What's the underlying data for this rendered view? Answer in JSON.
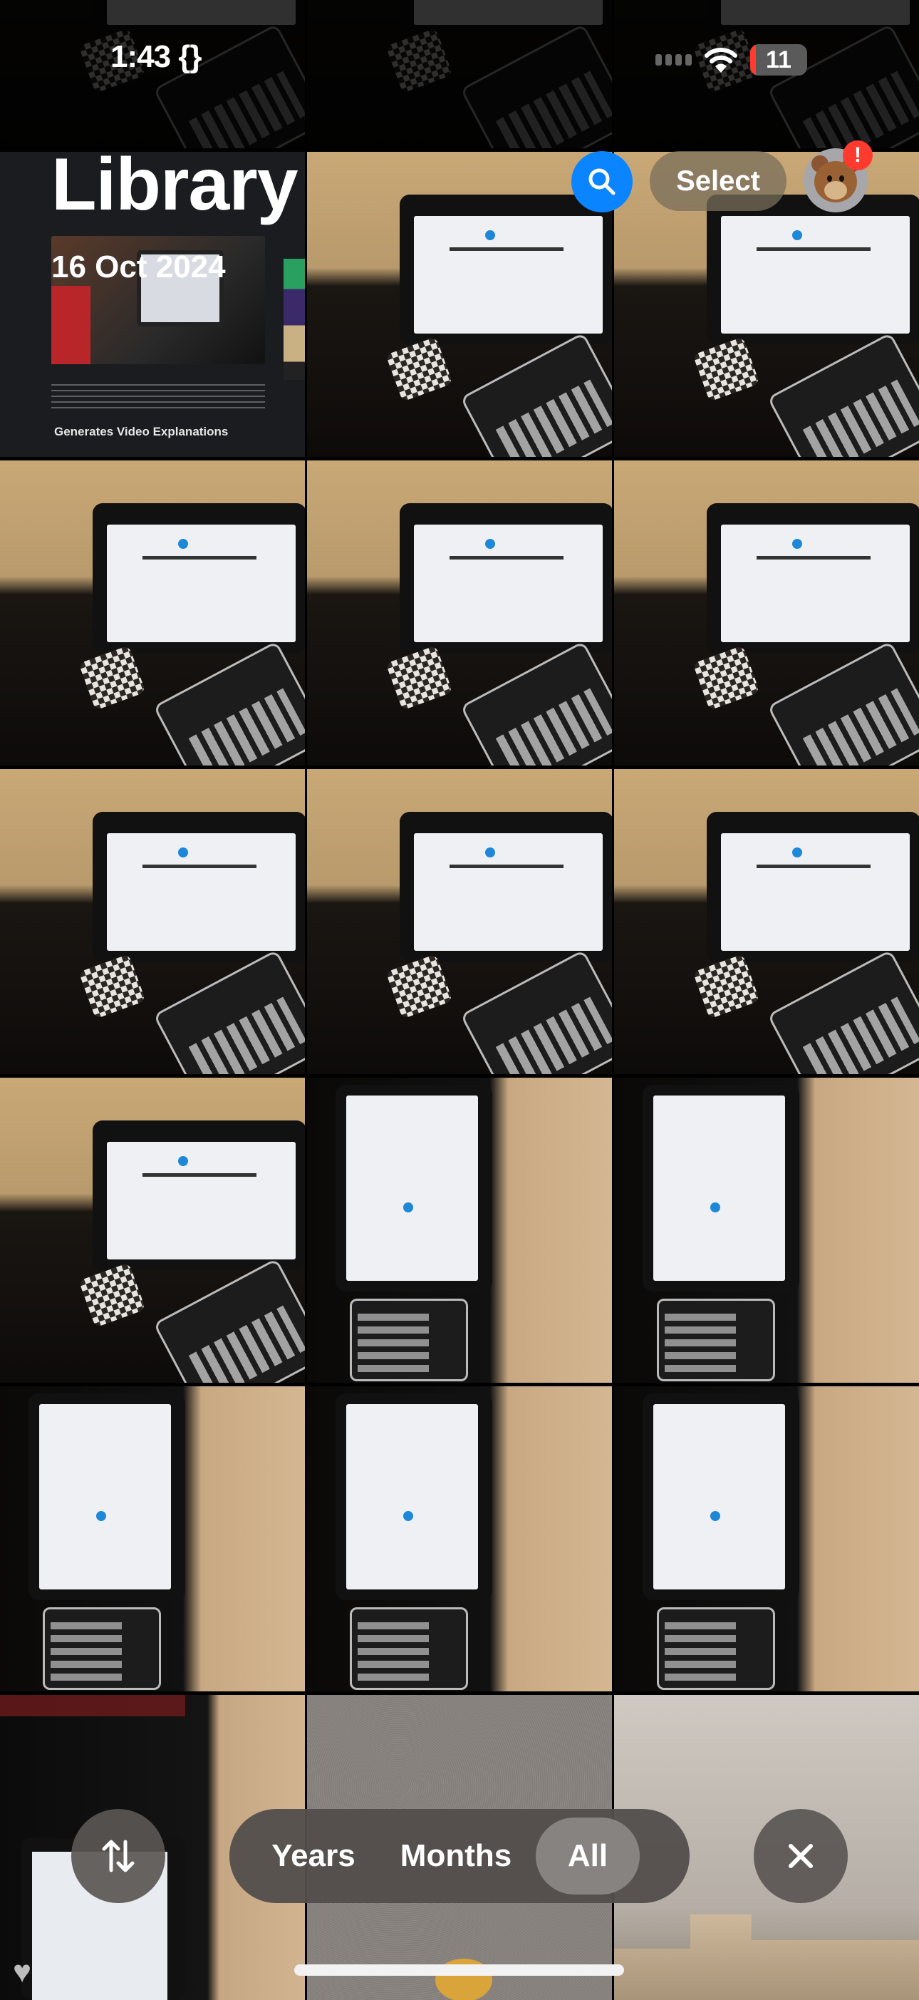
{
  "status_bar": {
    "time": "1:43 {}",
    "battery": "11",
    "battery_color": "#ff3b30",
    "wifi_icon": "wifi-icon",
    "signal_icon": "cellular-signal-icon"
  },
  "header": {
    "title": "Library",
    "date": "16 Oct 2024",
    "search_icon": "search-icon",
    "select_label": "Select",
    "avatar_icon": "bear-memoji-avatar",
    "alert_badge": "!"
  },
  "colors": {
    "accent": "#0a84ff",
    "alert": "#ff3b30"
  },
  "photos": [
    {
      "kind": "article",
      "heading": "Generates Video Explanations",
      "description": "Screenshot of article with image of iPad and calculator"
    },
    {
      "kind": "desk",
      "description": "iPad showing MathGPT with AirPods case and calculator"
    },
    {
      "kind": "desk",
      "description": "iPad showing MathGPT with AirPods case and calculator"
    },
    {
      "kind": "desk",
      "description": "iPad showing MathGPT with AirPods case and calculator"
    },
    {
      "kind": "desk",
      "description": "iPad showing MathGPT with AirPods case and calculator"
    },
    {
      "kind": "desk",
      "description": "iPad showing MathGPT with AirPods case and calculator"
    },
    {
      "kind": "desk",
      "description": "iPad showing MathGPT with AirPods case and calculator"
    },
    {
      "kind": "desk",
      "description": "iPad showing MathGPT with AirPods case and calculator"
    },
    {
      "kind": "desk",
      "description": "iPad showing MathGPT with AirPods case and calculator"
    },
    {
      "kind": "desk",
      "description": "iPad showing MathGPT with AirPods case and calculator"
    },
    {
      "kind": "rot",
      "description": "Rotated iPad with calculator and glasses"
    },
    {
      "kind": "rot",
      "description": "Rotated iPad with calculator"
    },
    {
      "kind": "rot",
      "description": "Rotated iPad with calculator"
    },
    {
      "kind": "rot",
      "description": "Rotated iPad with calculator"
    },
    {
      "kind": "rot",
      "description": "Rotated iPad with calculator"
    },
    {
      "kind": "dark",
      "description": "iPad on dark fabric"
    },
    {
      "kind": "wall",
      "description": "Textured wall with yellow object"
    },
    {
      "kind": "sky",
      "description": "Sky over building rooftop"
    }
  ],
  "bottom_bar": {
    "sort_icon": "sort-arrows-icon",
    "segments": [
      {
        "label": "Years",
        "selected": false
      },
      {
        "label": "Months",
        "selected": false
      },
      {
        "label": "All",
        "selected": true
      }
    ],
    "close_icon": "close-icon",
    "favorites_icon": "heart-icon"
  }
}
